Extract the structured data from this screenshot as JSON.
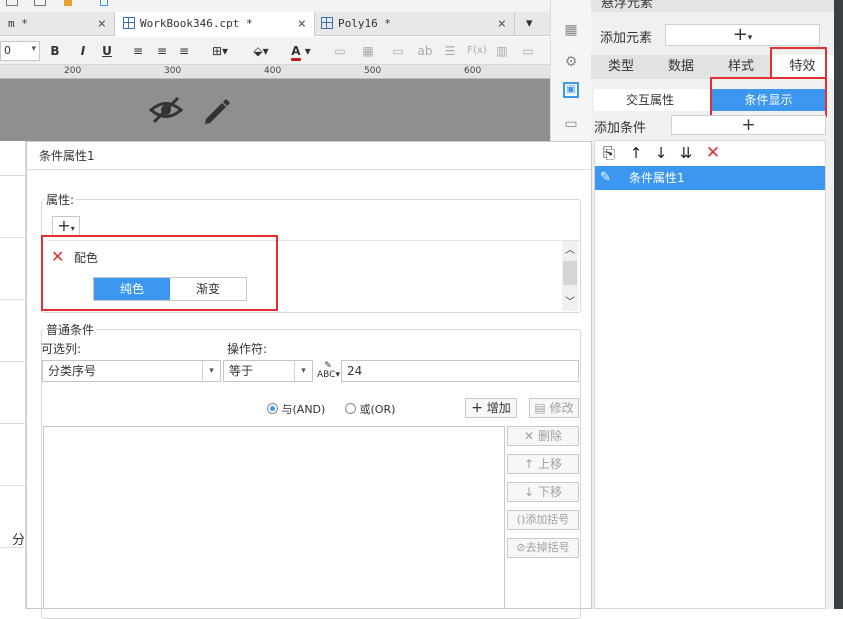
{
  "tabs": [
    {
      "label": "m *",
      "close": "×"
    },
    {
      "label": "WorkBook346.cpt *",
      "close": "×"
    },
    {
      "label": "Poly16 *",
      "close": "×"
    }
  ],
  "toolbar": {
    "font_size": "0",
    "bold": "B",
    "italic": "I",
    "underline": "U",
    "font_color": "A",
    "text_ab": "ab",
    "fx": "F(x)"
  },
  "ruler": {
    "ticks": [
      "200",
      "300",
      "400",
      "500",
      "600"
    ]
  },
  "left_fragments": {
    "char": "分"
  },
  "right_panel": {
    "top_partial": "悬浮元素",
    "add_element_label": "添加元素",
    "add_symbol": "+",
    "tabs": [
      "类型",
      "数据",
      "样式",
      "特效"
    ],
    "subtabs": [
      "交互属性",
      "条件显示"
    ],
    "add_condition_label": "添加条件",
    "list_items": [
      "条件属性1"
    ]
  },
  "dialog": {
    "title": "条件属性1",
    "properties_legend": "属性:",
    "add_button": "+",
    "property_name": "配色",
    "segments": [
      "纯色",
      "渐变"
    ],
    "common_legend": "普通条件",
    "column_label": "可选列:",
    "operator_label": "操作符:",
    "column_value": "分类序号",
    "operator_value": "等于",
    "input_value": "24",
    "radio_and": "与(AND)",
    "radio_or": "或(OR)",
    "btn_add": "增加",
    "btn_modify": "修改",
    "btn_delete": "删除",
    "btn_up": "上移",
    "btn_down": "下移",
    "btn_add_bracket": "添加括号",
    "btn_remove_bracket": "去掉括号"
  },
  "colors": {
    "accent": "#3c97f0",
    "red": "#e03030",
    "grey_canvas": "#8f8f8f"
  }
}
